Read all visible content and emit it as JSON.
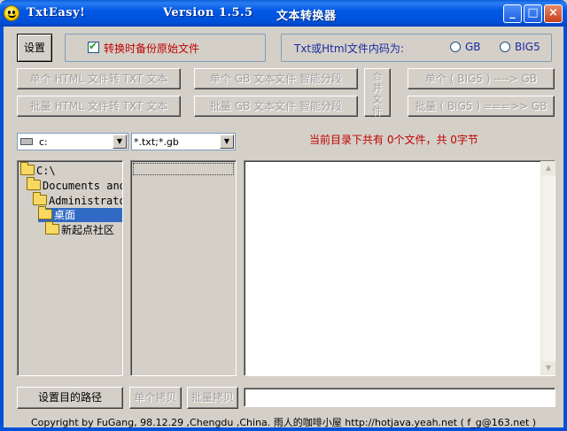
{
  "window": {
    "app_name": "TxtEasy!",
    "version": "Version 1.5.5",
    "subtitle": "文本转换器",
    "buttons": {
      "minimize": "_",
      "maximize": "□",
      "close": "×"
    }
  },
  "toolbar": {
    "settings_label": "设置",
    "backup_label": "转换时备份原始文件",
    "backup_checked": true,
    "encoding_label": "Txt或Html文件内码为:",
    "encoding_options": [
      "GB",
      "BIG5"
    ],
    "encoding_selected": ""
  },
  "actions": {
    "single_html_txt": "单个 HTML 文件转 TXT 文本",
    "batch_html_txt": "批量 HTML 文件转 TXT 文本",
    "single_gb_segment": "单个 GB 文本文件 智能分段",
    "batch_gb_segment": "批量 GB 文本文件 智能分段",
    "merge_files": "合并文件",
    "single_big5_gb": "单个 ( BIG5 ) ----> GB",
    "batch_big5_gb": "批量 ( BIG5 ) ===>> GB"
  },
  "filters": {
    "drive": "c:",
    "file_mask": "*.txt;*.gb",
    "status_text": "当前目录下共有 0个文件，共 0字节"
  },
  "tree": {
    "items": [
      {
        "label": "C:\\",
        "icon": "open-folder-icon",
        "selected": false
      },
      {
        "label": "Documents and",
        "icon": "open-folder-icon",
        "selected": false
      },
      {
        "label": "Administrato",
        "icon": "open-folder-icon",
        "selected": false
      },
      {
        "label": "桌面",
        "icon": "open-folder-icon",
        "selected": true
      },
      {
        "label": "新起点社区",
        "icon": "folder-icon",
        "selected": false
      }
    ]
  },
  "bottom": {
    "set_target_label": "设置目的路径",
    "single_copy_label": "单个拷贝",
    "batch_copy_label": "批量拷贝",
    "target_path": ""
  },
  "footer": {
    "copyright": "Copyright by FuGang, 98.12.29 ,Chengdu ,China. 雨人的咖啡小屋  http://hotjava.yeah.net ( f_g@163.net )"
  }
}
